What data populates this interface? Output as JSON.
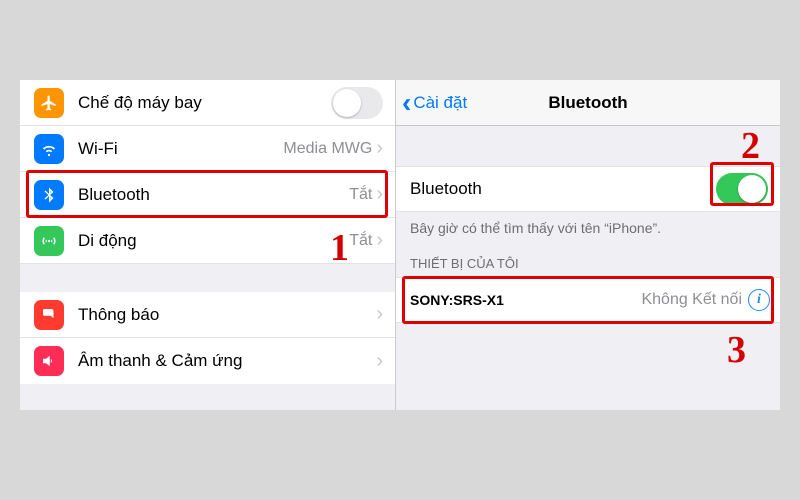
{
  "left": {
    "group1": [
      {
        "icon": "airplane",
        "label": "Chế độ máy bay",
        "type": "toggle",
        "on": false
      },
      {
        "icon": "wifi",
        "label": "Wi-Fi",
        "type": "link",
        "detail": "Media MWG"
      },
      {
        "icon": "bt",
        "label": "Bluetooth",
        "type": "link",
        "detail": "Tắt"
      },
      {
        "icon": "cell",
        "label": "Di động",
        "type": "link",
        "detail": "Tắt"
      }
    ],
    "group2": [
      {
        "icon": "notif",
        "label": "Thông báo",
        "type": "link"
      },
      {
        "icon": "sound",
        "label": "Âm thanh & Cảm ứng",
        "type": "link"
      }
    ]
  },
  "right": {
    "back_label": "Cài đặt",
    "title": "Bluetooth",
    "toggle_label": "Bluetooth",
    "toggle_on": true,
    "hint": "Bây giờ có thể tìm thấy với tên “iPhone”.",
    "section_header": "THIẾT BỊ CỦA TÔI",
    "devices": [
      {
        "name": "SONY:SRS-X1",
        "status": "Không Kết nối"
      }
    ]
  },
  "steps": {
    "s1": "1",
    "s2": "2",
    "s3": "3"
  }
}
